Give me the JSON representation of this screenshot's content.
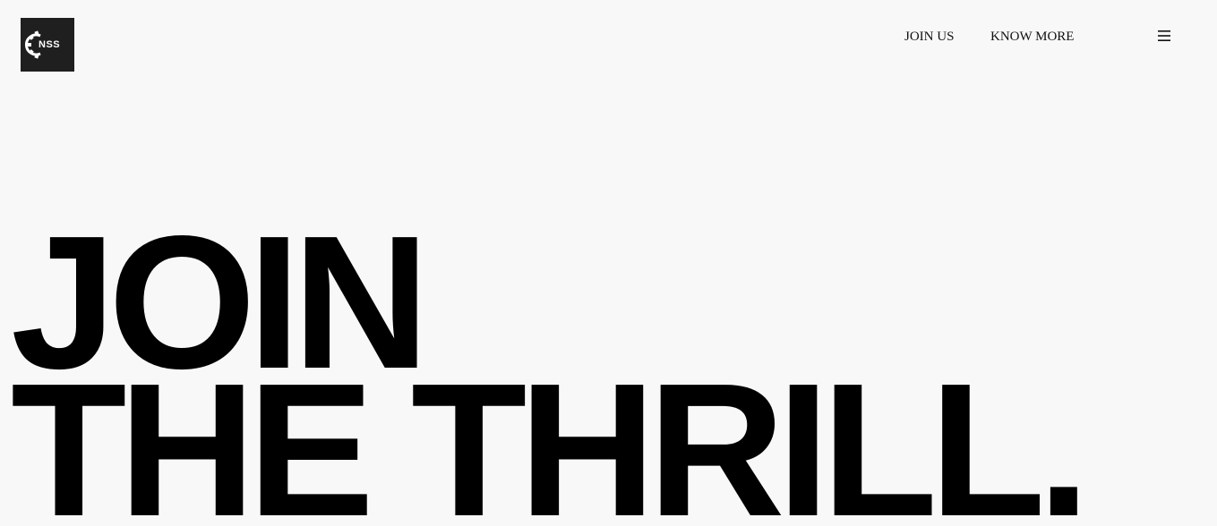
{
  "header": {
    "logo_text": "NSS",
    "nav": {
      "join_label": "JOIN US",
      "know_label": "KNOW MORE"
    },
    "menu_icon": "hamburger-icon"
  },
  "hero": {
    "line1": "JOIN",
    "line2": "THE THRILL."
  },
  "colors": {
    "background": "#f8f8f8",
    "text": "#000000",
    "logo_bg": "#1f1f1f"
  }
}
